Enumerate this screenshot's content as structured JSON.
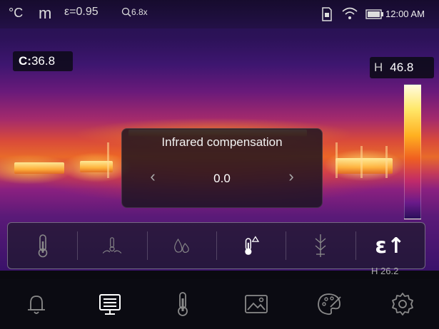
{
  "status_bar": {
    "unit_celsius": "°C",
    "unit_distance": "m",
    "emissivity": "ε=0.95",
    "zoom": "6.8x",
    "time": "12:00 AM"
  },
  "readouts": {
    "center_label": "C:",
    "center_value": "36.8",
    "high_label": "H",
    "high_value": "46.8",
    "below_partial": "H 26.2"
  },
  "dialog": {
    "title": "Infrared compensation",
    "value": "0.0",
    "left_arrow": "‹",
    "right_arrow": "›"
  },
  "settings_row": {
    "icons": [
      "thermometer-icon",
      "reflected-temperature-icon",
      "humidity-icon",
      "infrared-compensation-icon",
      "distance-icon",
      "emissivity-icon"
    ],
    "selected_index": 3,
    "emissivity_glyph": "ε↑"
  },
  "toolbar": {
    "icons": [
      "alarm-bell-icon",
      "display-mode-icon",
      "measurement-icon",
      "image-icon",
      "palette-icon",
      "settings-gear-icon"
    ],
    "selected_index": 1
  },
  "colors": {
    "icon_default": "#8a8a8a",
    "icon_active": "#ffffff"
  }
}
